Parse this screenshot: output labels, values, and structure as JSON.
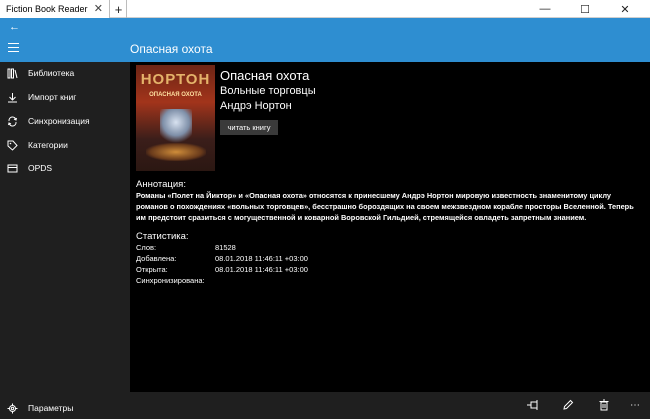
{
  "window": {
    "tab_title": "Fiction Book Reader",
    "tab_close": "✕",
    "new_tab": "+",
    "minimize": "—",
    "maximize": "☐",
    "close": "✕"
  },
  "header": {
    "back_icon": "←",
    "page_title": "Опасная охота"
  },
  "sidebar": {
    "items": [
      {
        "label": "Библиотека",
        "icon": "library-icon"
      },
      {
        "label": "Импорт книг",
        "icon": "download-icon"
      },
      {
        "label": "Синхронизация",
        "icon": "sync-icon"
      },
      {
        "label": "Категории",
        "icon": "tag-icon"
      },
      {
        "label": "OPDS",
        "icon": "opds-icon"
      }
    ],
    "settings_label": "Параметры"
  },
  "book": {
    "cover_title": "НОРТОН",
    "cover_subtitle": "ОПАСНАЯ ОХОТА",
    "title": "Опасная охота",
    "series": "Вольные торговцы",
    "author": "Андрэ Нортон",
    "read_button": "читать книгу"
  },
  "annotation": {
    "heading": "Аннотация:",
    "text": "Романы «Полет на Йиктор» и «Опасная охота» относятся к принесшему Андрэ Нортон мировую известность знаменитому циклу романов о похождениях «вольных торговцев», бесстрашно бороздящих на своем межзвездном корабле просторы Вселенной. Теперь им предстоит сразиться с могущественной и коварной Воровской Гильдией, стремящейся овладеть запретным знанием."
  },
  "stats": {
    "heading": "Статистика:",
    "rows": [
      {
        "label": "Слов:",
        "value": "81528"
      },
      {
        "label": "Добавлена:",
        "value": "08.01.2018 11:46:11 +03:00"
      },
      {
        "label": "Открыта:",
        "value": "08.01.2018 11:46:11 +03:00"
      },
      {
        "label": "Синхронизирована:",
        "value": ""
      }
    ]
  },
  "toolbar": {
    "pin_icon": "pin-icon",
    "edit_icon": "pencil-icon",
    "delete_icon": "trash-icon",
    "more_icon": "more-icon",
    "more_glyph": "⋯"
  },
  "colors": {
    "accent": "#2e8ed1",
    "sidebar_bg": "#1f1f1f",
    "content_bg": "#000000"
  }
}
